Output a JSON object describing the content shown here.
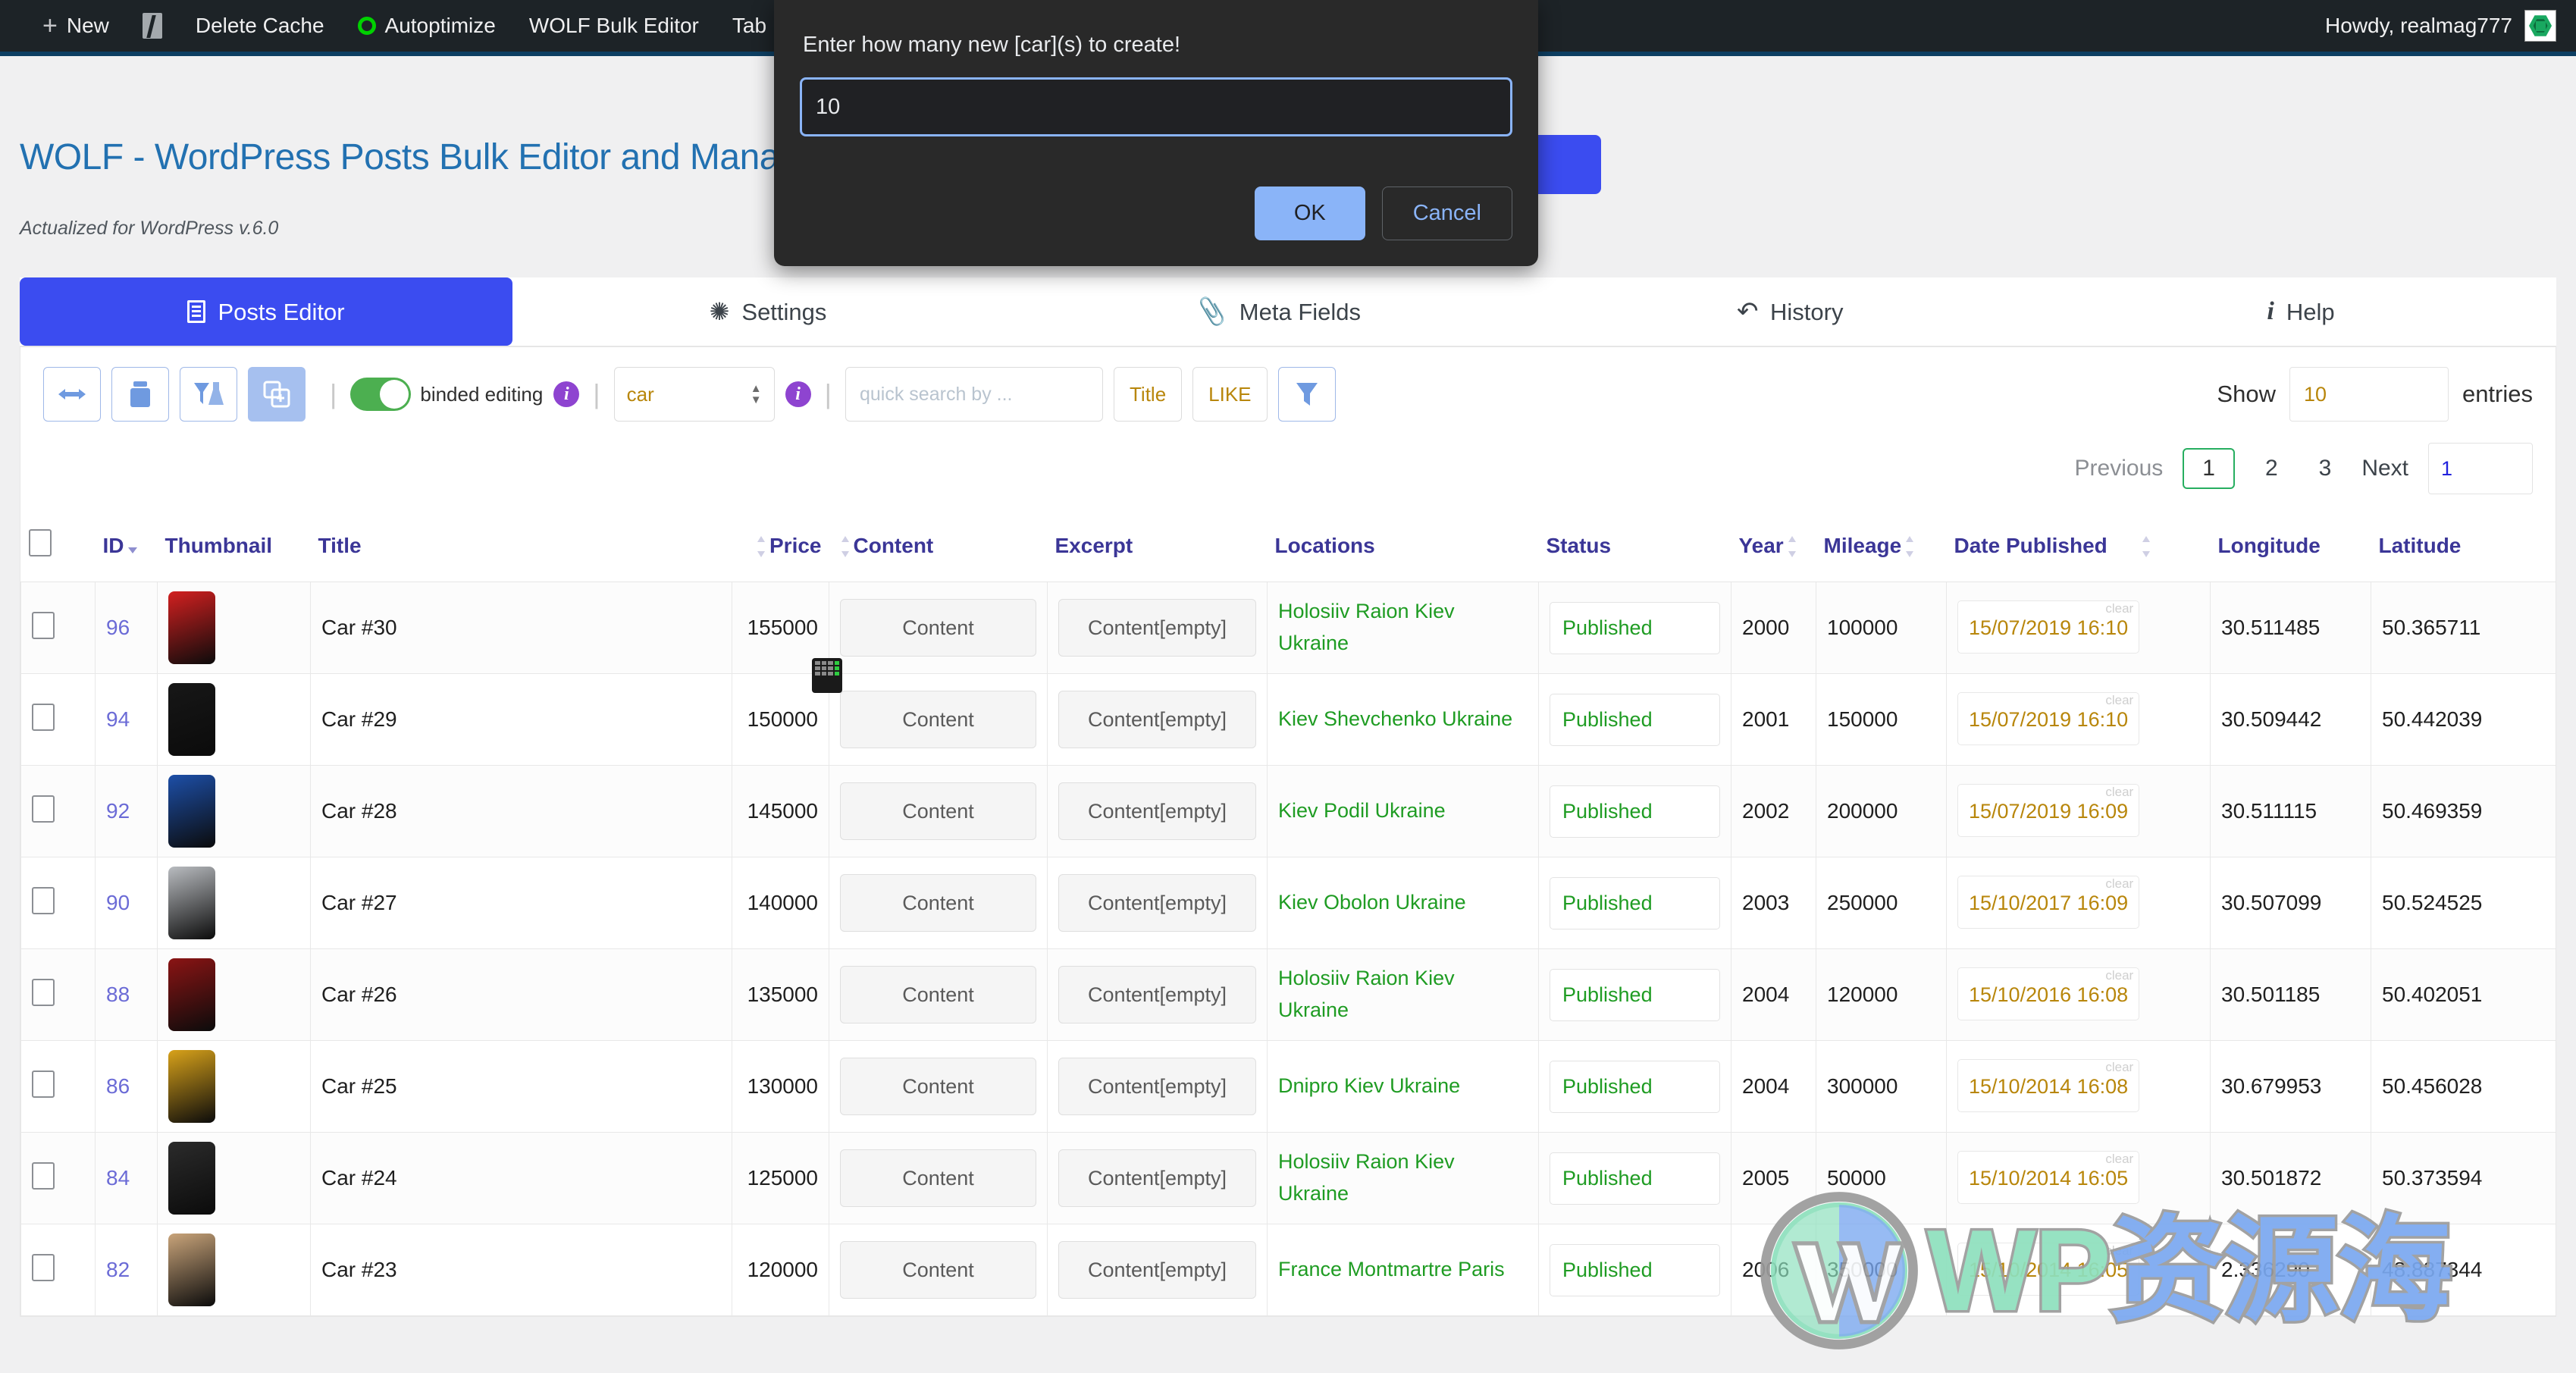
{
  "adminbar": {
    "new_label": "New",
    "yoast_icon": "yoast-icon",
    "items": [
      {
        "label": "Delete Cache",
        "icon": null
      },
      {
        "label": "Autoptimize",
        "icon": "circle-icon"
      },
      {
        "label": "WOLF Bulk Editor",
        "icon": null
      },
      {
        "label": "Tab",
        "icon": null
      }
    ],
    "howdy": "Howdy, realmag777",
    "avatar": "avatar"
  },
  "page": {
    "title": "WOLF - WordPress Posts Bulk Editor and Manager Professional",
    "subtitle": "Actualized for WordPress v.6.0"
  },
  "tabs": [
    {
      "label": "Posts Editor",
      "icon": "book-icon",
      "active": true
    },
    {
      "label": "Settings",
      "icon": "gear-icon",
      "active": false
    },
    {
      "label": "Meta Fields",
      "icon": "paperclip-icon",
      "active": false
    },
    {
      "label": "History",
      "icon": "undo-icon",
      "active": false
    },
    {
      "label": "Help",
      "icon": "info-icon",
      "active": false
    }
  ],
  "toolbar": {
    "buttons": [
      {
        "name": "resize-columns-button",
        "icon": "arrows-horizontal-icon"
      },
      {
        "name": "folder-button",
        "icon": "folder-icon"
      },
      {
        "name": "filter-lab-button",
        "icon": "funnel-flask-icon"
      },
      {
        "name": "duplicate-button",
        "icon": "copy-plus-icon",
        "active": true
      }
    ],
    "binded_editing_label": "binded editing",
    "binded_editing_on": true,
    "info_icon": "info-circle-icon",
    "post_type": "car",
    "quick_search_placeholder": "quick search by ...",
    "search_field_label": "Title",
    "search_operator_label": "LIKE",
    "apply_filter_icon": "funnel-icon",
    "show_label": "Show",
    "show_value": "10",
    "entries_label": "entries"
  },
  "pagination": {
    "previous": "Previous",
    "pages": [
      "1",
      "2",
      "3"
    ],
    "current": "1",
    "next": "Next",
    "goto_value": "1"
  },
  "table": {
    "columns": [
      {
        "label": "",
        "name": "select-all",
        "sortable": false
      },
      {
        "label": "ID",
        "name": "col-id",
        "sortable": true,
        "sorted": "desc"
      },
      {
        "label": "Thumbnail",
        "name": "col-thumbnail",
        "sortable": false
      },
      {
        "label": "Title",
        "name": "col-title",
        "sortable": true
      },
      {
        "label": "Price",
        "name": "col-price",
        "sortable": true
      },
      {
        "label": "Content",
        "name": "col-content",
        "sortable": false
      },
      {
        "label": "Excerpt",
        "name": "col-excerpt",
        "sortable": false
      },
      {
        "label": "Locations",
        "name": "col-locations",
        "sortable": false
      },
      {
        "label": "Status",
        "name": "col-status",
        "sortable": false
      },
      {
        "label": "Year",
        "name": "col-year",
        "sortable": true
      },
      {
        "label": "Mileage",
        "name": "col-mileage",
        "sortable": true
      },
      {
        "label": "Date Published",
        "name": "col-date-published",
        "sortable": true
      },
      {
        "label": "Longitude",
        "name": "col-longitude",
        "sortable": false
      },
      {
        "label": "Latitude",
        "name": "col-latitude",
        "sortable": false
      }
    ],
    "cell_labels": {
      "content_button": "Content",
      "excerpt_button": "Content[empty]",
      "clear_label": "clear"
    },
    "rows": [
      {
        "id": "96",
        "thumb": "#d32020",
        "title": "Car #30",
        "price": "155000",
        "content": "Content",
        "excerpt": "Content[empty]",
        "locations": "Holosiiv Raion  Kiev  Ukraine",
        "status": "Published",
        "year": "2000",
        "mileage": "100000",
        "date": "15/07/2019 16:10",
        "lon": "30.511485",
        "lat": "50.365711"
      },
      {
        "id": "94",
        "thumb": "#171717",
        "title": "Car #29",
        "price": "150000",
        "content": "Content",
        "excerpt": "Content[empty]",
        "locations": "Kiev  Shevchenko  Ukraine",
        "status": "Published",
        "year": "2001",
        "mileage": "150000",
        "date": "15/07/2019 16:10",
        "lon": "30.509442",
        "lat": "50.442039"
      },
      {
        "id": "92",
        "thumb": "#1d4fa8",
        "title": "Car #28",
        "price": "145000",
        "content": "Content",
        "excerpt": "Content[empty]",
        "locations": "Kiev  Podil  Ukraine",
        "status": "Published",
        "year": "2002",
        "mileage": "200000",
        "date": "15/07/2019 16:09",
        "lon": "30.511115",
        "lat": "50.469359"
      },
      {
        "id": "90",
        "thumb": "#b9bcc0",
        "title": "Car #27",
        "price": "140000",
        "content": "Content",
        "excerpt": "Content[empty]",
        "locations": "Kiev  Obolon  Ukraine",
        "status": "Published",
        "year": "2003",
        "mileage": "250000",
        "date": "15/10/2017 16:09",
        "lon": "30.507099",
        "lat": "50.524525"
      },
      {
        "id": "88",
        "thumb": "#8b1414",
        "title": "Car #26",
        "price": "135000",
        "content": "Content",
        "excerpt": "Content[empty]",
        "locations": "Holosiiv Raion  Kiev  Ukraine",
        "status": "Published",
        "year": "2004",
        "mileage": "120000",
        "date": "15/10/2016 16:08",
        "lon": "30.501185",
        "lat": "50.402051"
      },
      {
        "id": "86",
        "thumb": "#d8a21a",
        "title": "Car #25",
        "price": "130000",
        "content": "Content",
        "excerpt": "Content[empty]",
        "locations": "Dnipro  Kiev  Ukraine",
        "status": "Published",
        "year": "2004",
        "mileage": "300000",
        "date": "15/10/2014 16:08",
        "lon": "30.679953",
        "lat": "50.456028"
      },
      {
        "id": "84",
        "thumb": "#2b2b2b",
        "title": "Car #24",
        "price": "125000",
        "content": "Content",
        "excerpt": "Content[empty]",
        "locations": "Holosiiv Raion  Kiev  Ukraine",
        "status": "Published",
        "year": "2005",
        "mileage": "50000",
        "date": "15/10/2014 16:05",
        "lon": "30.501872",
        "lat": "50.373594"
      },
      {
        "id": "82",
        "thumb": "#c9a47a",
        "title": "Car #23",
        "price": "120000",
        "content": "Content",
        "excerpt": "Content[empty]",
        "locations": "France  Montmartre  Paris",
        "status": "Published",
        "year": "2006",
        "mileage": "350000",
        "date": "15/10/2014 16:05",
        "lon": "2.336290",
        "lat": "48.887344"
      }
    ]
  },
  "dialog": {
    "message": "Enter how many new [car](s) to create!",
    "input_value": "10",
    "ok_label": "OK",
    "cancel_label": "Cancel"
  },
  "watermark": {
    "prefix": "WP",
    "suffix": "资源海"
  },
  "colors": {
    "adminbar_bg": "#1d2327",
    "accent_blue": "#3b4cf0",
    "title_blue": "#2271b1",
    "header_purple": "#3b3697",
    "status_green": "#1f9c23",
    "date_gold": "#b8860b",
    "dialog_bg": "#292929",
    "dialog_accent": "#8ab4f8"
  }
}
